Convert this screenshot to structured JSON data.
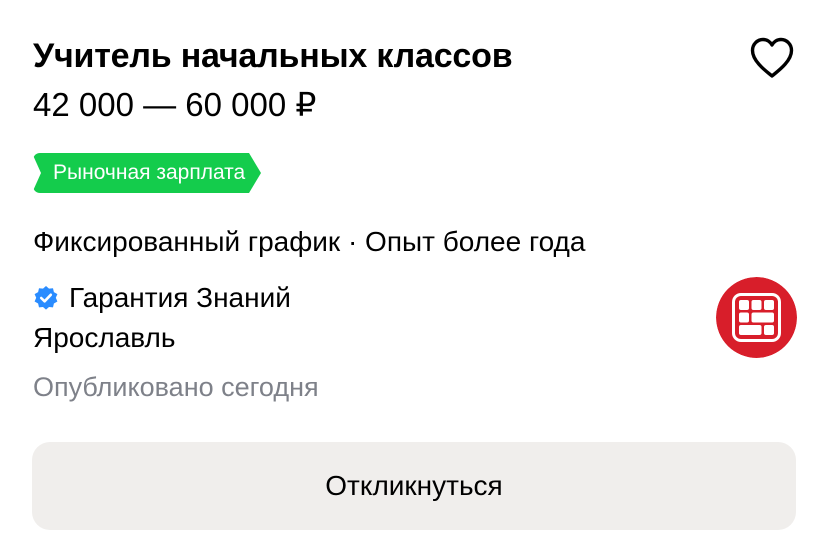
{
  "vacancy": {
    "title": "Учитель начальных классов",
    "salary": "42 000 — 60 000 ₽",
    "badge": "Рыночная зарплата",
    "conditions": "Фиксированный график · Опыт более года",
    "company": "Гарантия Знаний",
    "city": "Ярославль",
    "published": "Опубликовано сегодня",
    "respond_label": "Откликнуться"
  },
  "icons": {
    "favorite": "heart-icon",
    "verified": "verified-check-icon",
    "logo": "company-logo"
  },
  "colors": {
    "badge_bg": "#14cc4c",
    "verified": "#2a8cff",
    "logo": "#d81e2a",
    "button_bg": "#f0eeec",
    "muted_text": "#7e8189"
  }
}
